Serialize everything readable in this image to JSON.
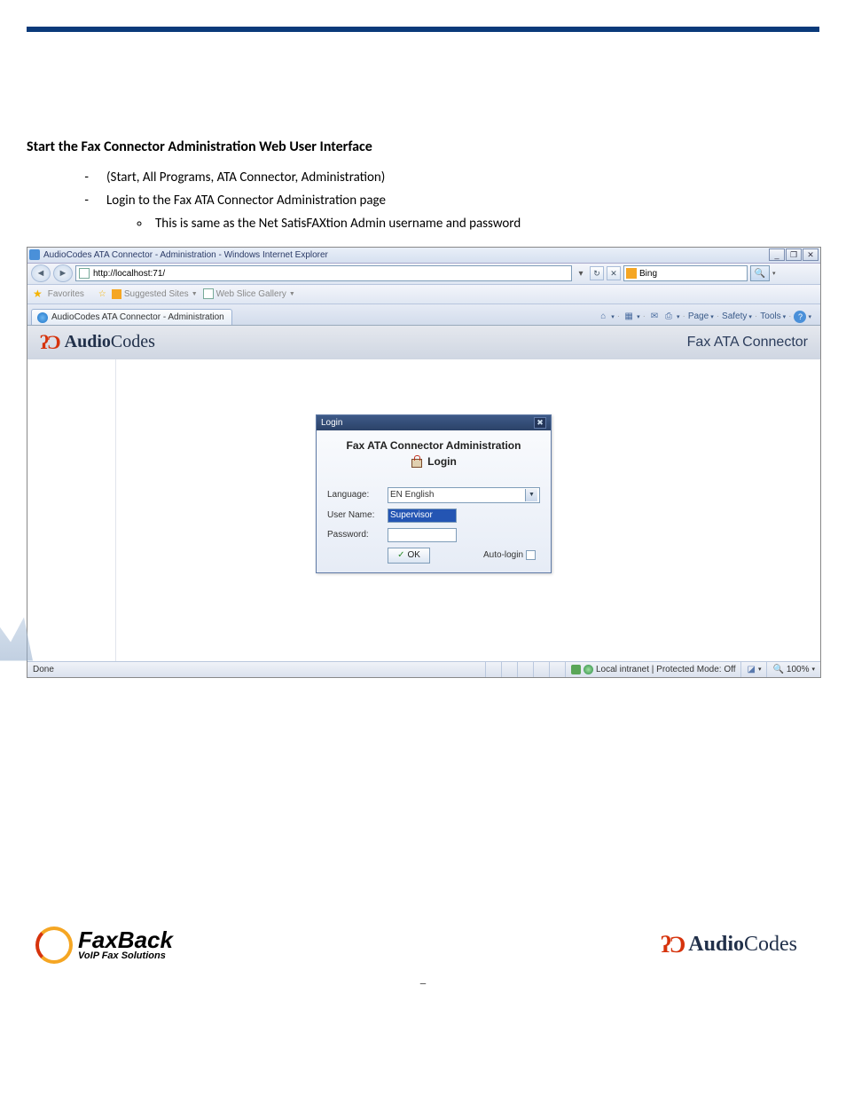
{
  "doc": {
    "heading": "Start the Fax Connector Administration Web User Interface",
    "b1": "(Start, All Programs, ATA Connector, Administration)",
    "b2": "Login to the Fax ATA Connector Administration page",
    "b2a": "This is same as the Net SatisFAXtion Admin username and password"
  },
  "browser": {
    "title": "AudioCodes ATA Connector - Administration - Windows Internet Explorer",
    "url": "http://localhost:71/",
    "search_engine": "Bing",
    "fav_label": "Favorites",
    "fav_suggested": "Suggested Sites",
    "fav_gallery": "Web Slice Gallery",
    "tab_label": "AudioCodes ATA Connector - Administration",
    "tools": {
      "page": "Page",
      "safety": "Safety",
      "tools": "Tools"
    },
    "status": {
      "left": "Done",
      "zone": "Local intranet | Protected Mode: Off",
      "zoom": "100%"
    }
  },
  "app": {
    "logo_text_a": "Audio",
    "logo_text_b": "Codes",
    "header_title": "Fax ATA Connector"
  },
  "login": {
    "win_title": "Login",
    "heading": "Fax ATA Connector Administration",
    "sub": "Login",
    "lang_label": "Language:",
    "lang_value": "EN English",
    "user_label": "User Name:",
    "user_value": "Supervisor",
    "pass_label": "Password:",
    "pass_value": "",
    "ok": "OK",
    "autologin": "Auto-login"
  },
  "footer": {
    "fb_main": "FaxBack",
    "fb_sub": "VoIP Fax Solutions",
    "page_marker": "_"
  }
}
